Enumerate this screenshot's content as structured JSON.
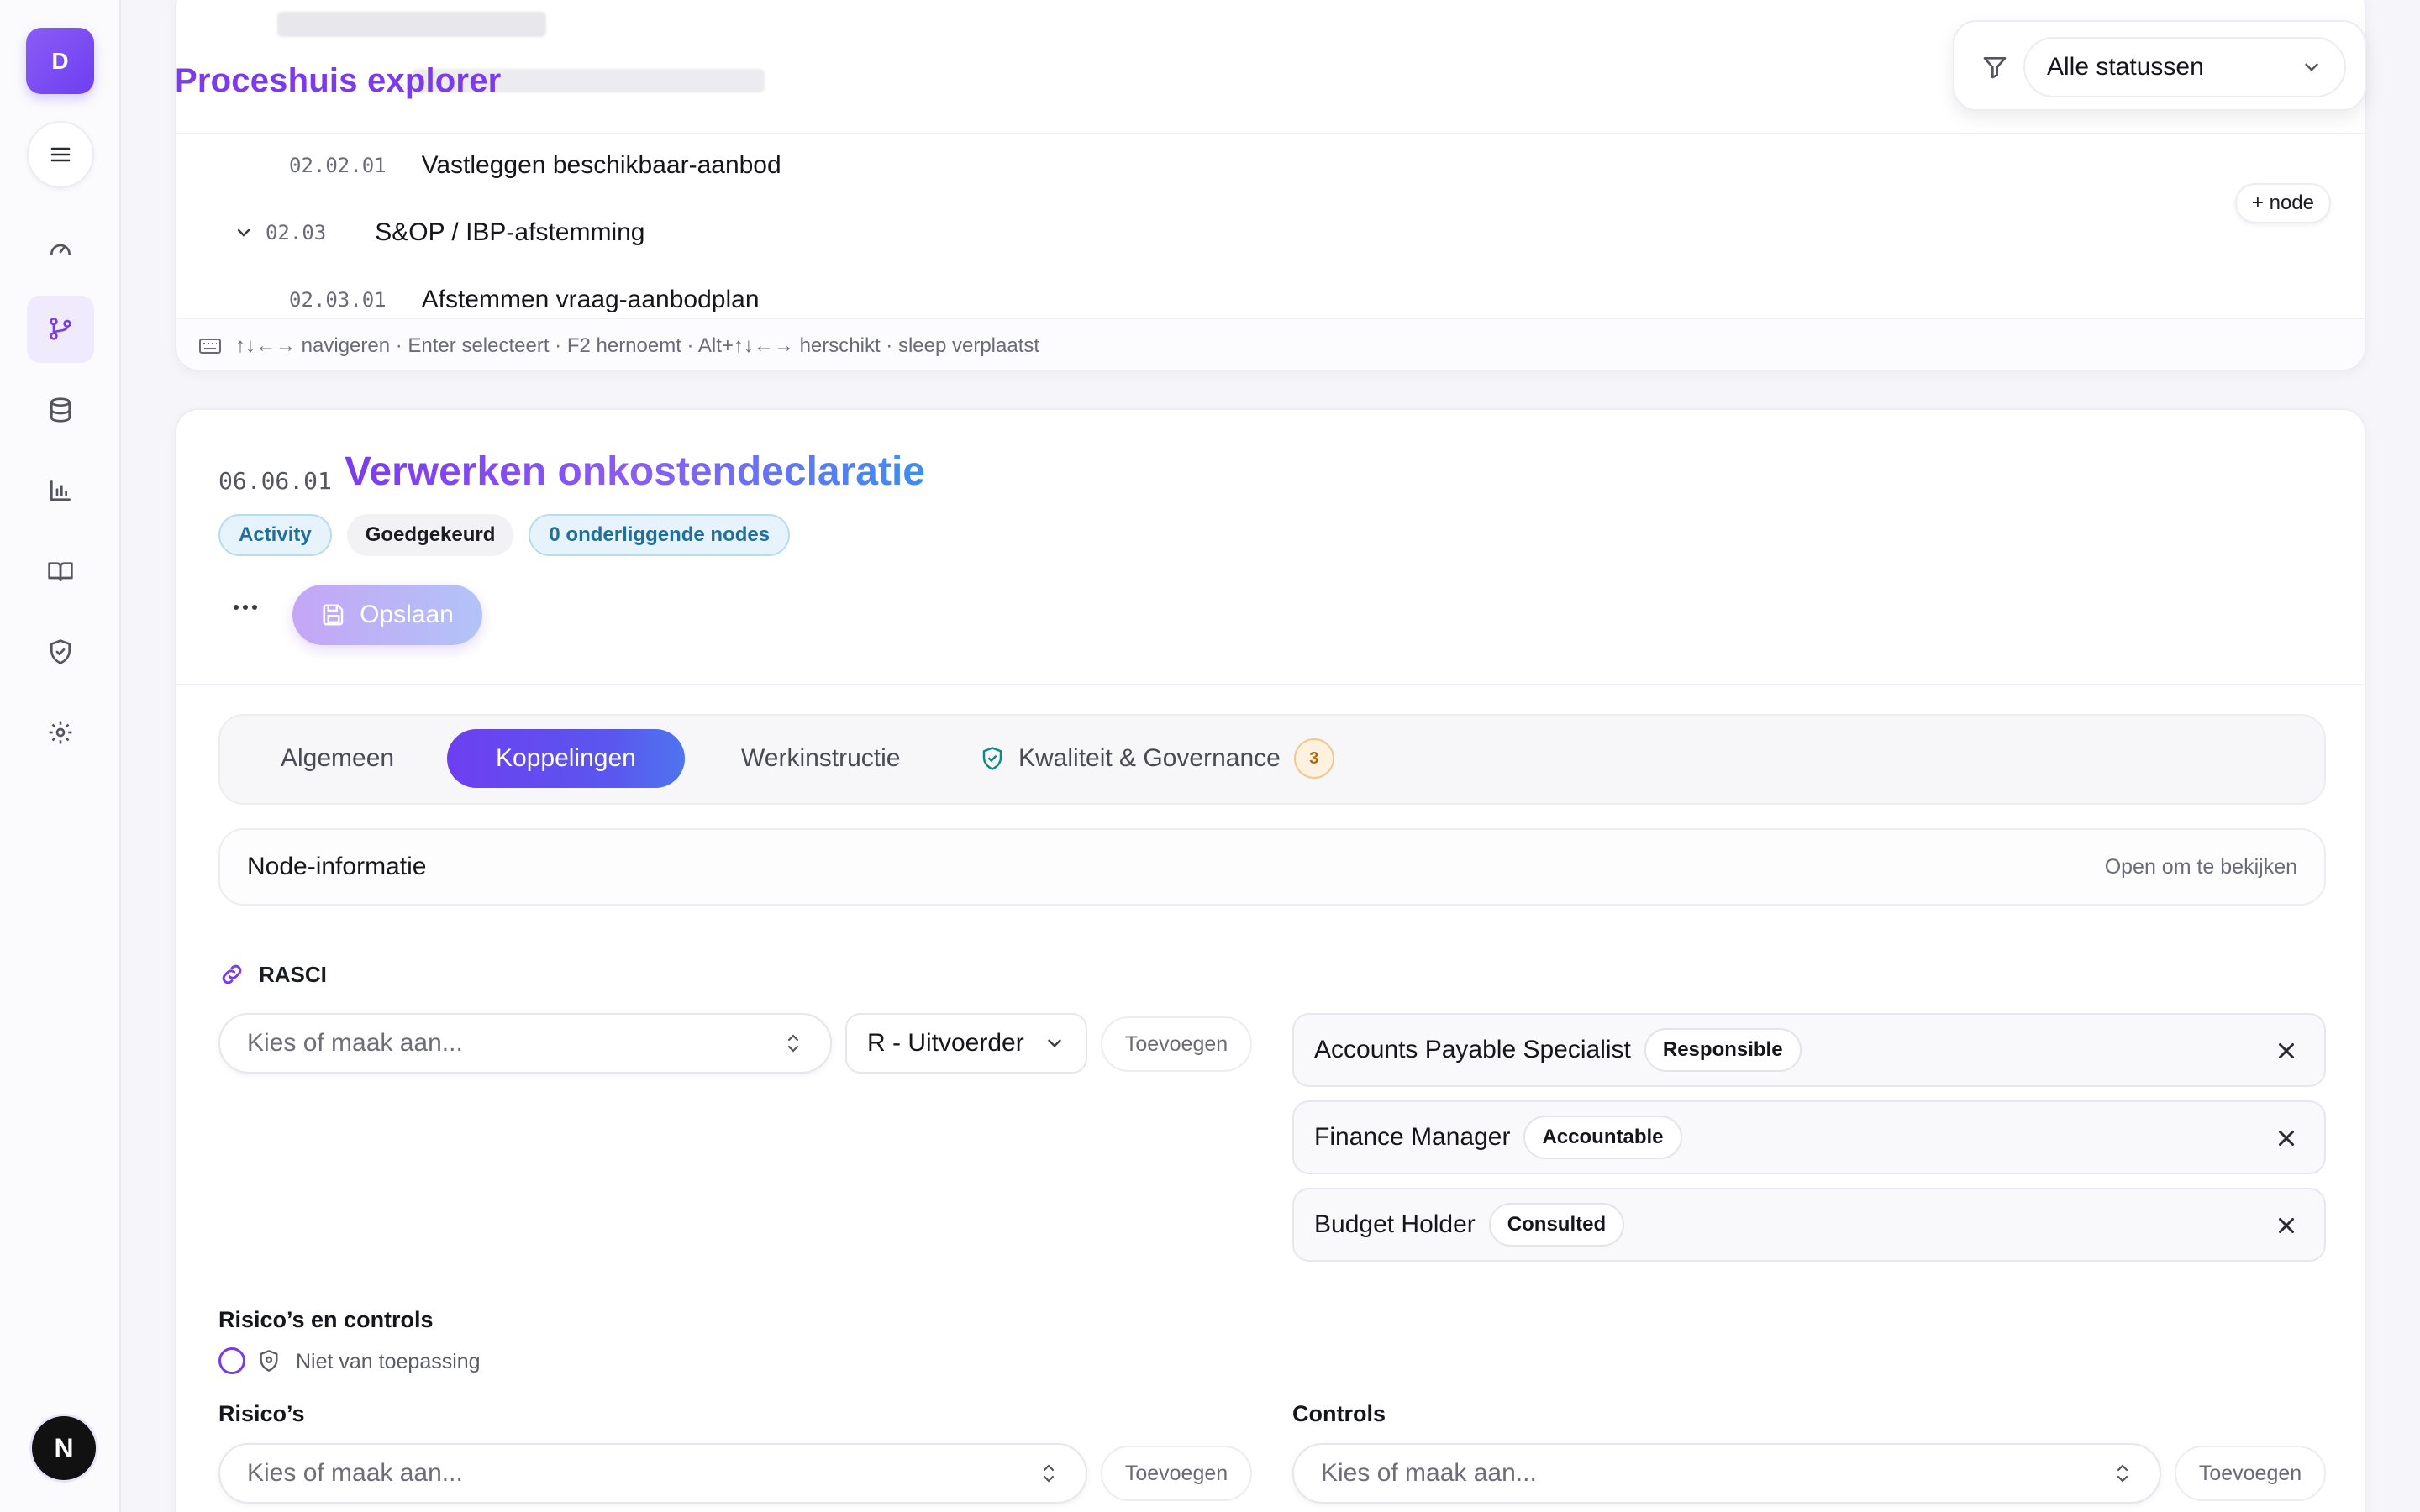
{
  "sidebar": {
    "avatar_initial": "D",
    "items": [
      {
        "icon": "gauge-icon",
        "active": false
      },
      {
        "icon": "git-branch-icon",
        "active": true
      },
      {
        "icon": "database-icon",
        "active": false
      },
      {
        "icon": "bar-chart-icon",
        "active": false
      },
      {
        "icon": "book-icon",
        "active": false
      },
      {
        "icon": "shield-check-icon",
        "active": false
      },
      {
        "icon": "gear-icon",
        "active": false
      }
    ],
    "bottom_badge": "N"
  },
  "explorer": {
    "title": "Proceshuis explorer",
    "filter": {
      "value": "Alle statussen"
    },
    "rows": [
      {
        "code": "02.02.01",
        "label": "Vastleggen beschikbaar-aanbod"
      },
      {
        "code": "02.03",
        "label": "S&OP / IBP-afstemming",
        "action": "+ node"
      },
      {
        "code": "02.03.01",
        "label": "Afstemmen vraag-aanbodplan"
      }
    ],
    "keyboard_hint": "↑↓←→ navigeren · Enter selecteert · F2 hernoemt · Alt+↑↓←→ herschikt · sleep verplaatst"
  },
  "detail": {
    "code": "06.06.01",
    "title": "Verwerken onkostendeclaratie",
    "badges": [
      "Activity",
      "Goedgekeurd",
      "0 onderliggende nodes"
    ],
    "save_label": "Opslaan",
    "tabs": [
      {
        "label": "Algemeen",
        "active": false
      },
      {
        "label": "Koppelingen",
        "active": true
      },
      {
        "label": "Werkinstructie",
        "active": false
      },
      {
        "label": "Kwaliteit & Governance",
        "active": false,
        "count": "3"
      }
    ],
    "node_info": {
      "title": "Node-informatie",
      "hint": "Open om te bekijken"
    },
    "rasci": {
      "title": "RASCI",
      "placeholder": "Kies of maak aan...",
      "role_select": "R - Uitvoerder",
      "add_label": "Toevoegen",
      "assignments": [
        {
          "name": "Accounts Payable Specialist",
          "role": "Responsible"
        },
        {
          "name": "Finance Manager",
          "role": "Accountable"
        },
        {
          "name": "Budget Holder",
          "role": "Consulted"
        }
      ]
    },
    "risks_controls": {
      "title": "Risico’s en controls",
      "not_applicable": "Niet van toepassing",
      "risks_label": "Risico’s",
      "controls_label": "Controls",
      "placeholder": "Kies of maak aan...",
      "add_label": "Toevoegen"
    }
  },
  "colors": {
    "accent": "#7c3aed",
    "accent_blue": "#3b8ff0"
  }
}
